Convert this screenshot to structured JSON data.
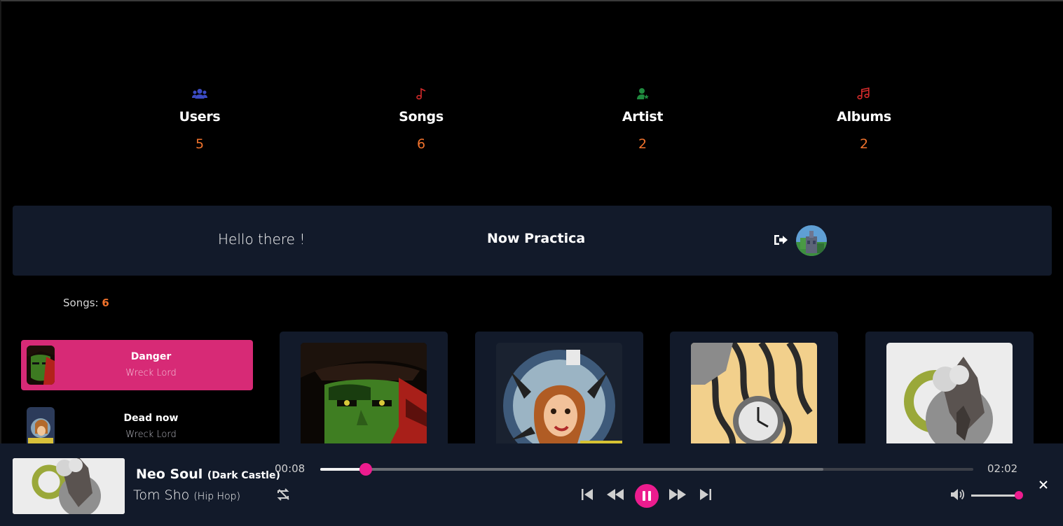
{
  "stats": [
    {
      "icon": "users-icon",
      "label": "Users",
      "value": "5",
      "color": "#3b4bc4"
    },
    {
      "icon": "music-note-icon",
      "label": "Songs",
      "value": "6",
      "color": "#d42b2b"
    },
    {
      "icon": "artist-icon",
      "label": "Artist",
      "value": "2",
      "color": "#1f8a3e"
    },
    {
      "icon": "music-notes-icon",
      "label": "Albums",
      "value": "2",
      "color": "#d42b2b"
    }
  ],
  "header": {
    "greeting": "Hello there !",
    "username": "Now Practica"
  },
  "song_count": {
    "label": "Songs:",
    "value": "6"
  },
  "song_list": [
    {
      "title": "Danger",
      "artist": "Wreck Lord",
      "active": true
    },
    {
      "title": "Dead now",
      "artist": "Wreck Lord",
      "active": false
    }
  ],
  "player": {
    "title": "Neo Soul",
    "album": "(Dark Castle)",
    "artist": "Tom Sho",
    "genre": "(Hip Hop)",
    "current_time": "00:08",
    "total_time": "02:02",
    "progress": 0.07,
    "buffered": 0.77,
    "volume": 1.0
  },
  "colors": {
    "accent": "#ec1c8e",
    "active_item": "#d72a76",
    "number": "#f0722c",
    "panel": "#121a2a"
  }
}
